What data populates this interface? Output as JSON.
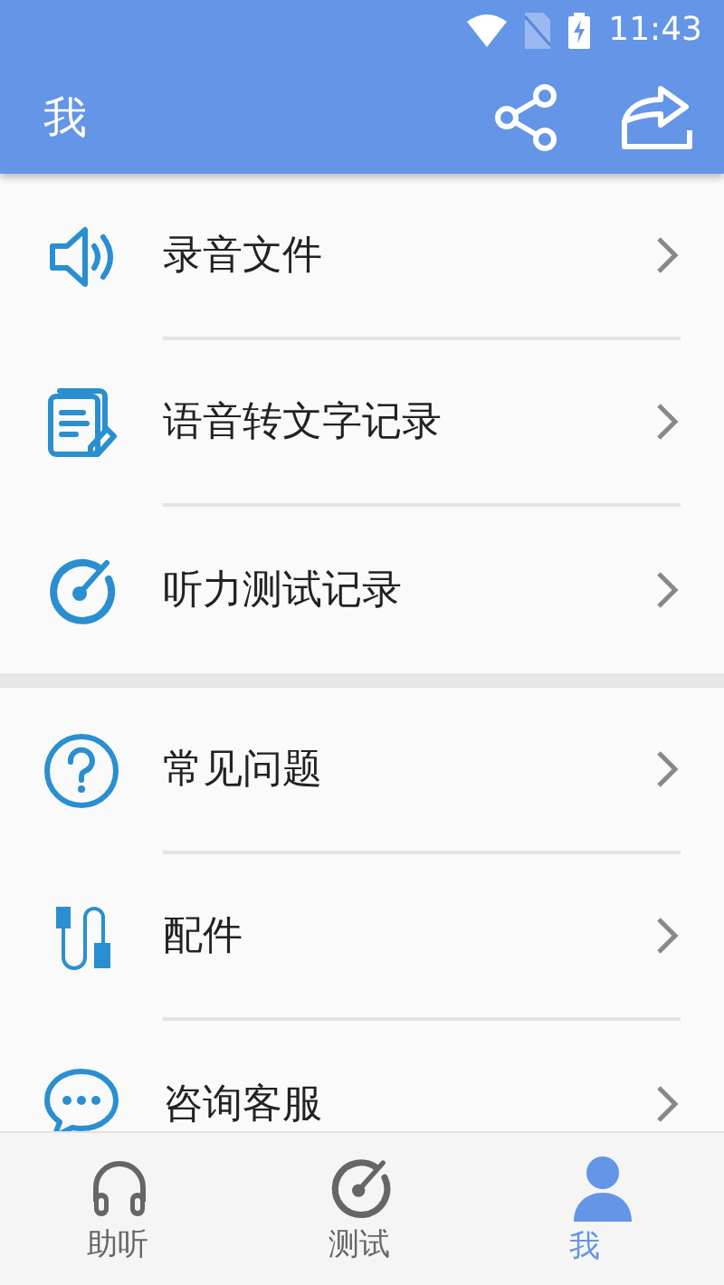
{
  "status_bar": {
    "time": "11:43"
  },
  "app_bar": {
    "title": "我"
  },
  "sections": [
    {
      "items": [
        {
          "kind": "audio",
          "label": "录音文件"
        },
        {
          "kind": "notes",
          "label": "语音转文字记录"
        },
        {
          "kind": "gauge",
          "label": "听力测试记录"
        }
      ]
    },
    {
      "items": [
        {
          "kind": "help",
          "label": "常见问题"
        },
        {
          "kind": "cable",
          "label": "配件"
        },
        {
          "kind": "chat",
          "label": "咨询客服"
        }
      ]
    }
  ],
  "bottom_nav": [
    {
      "kind": "headphones",
      "label": "助听",
      "selected": false
    },
    {
      "kind": "gauge",
      "label": "测试",
      "selected": false
    },
    {
      "kind": "person",
      "label": "我",
      "selected": true
    }
  ]
}
